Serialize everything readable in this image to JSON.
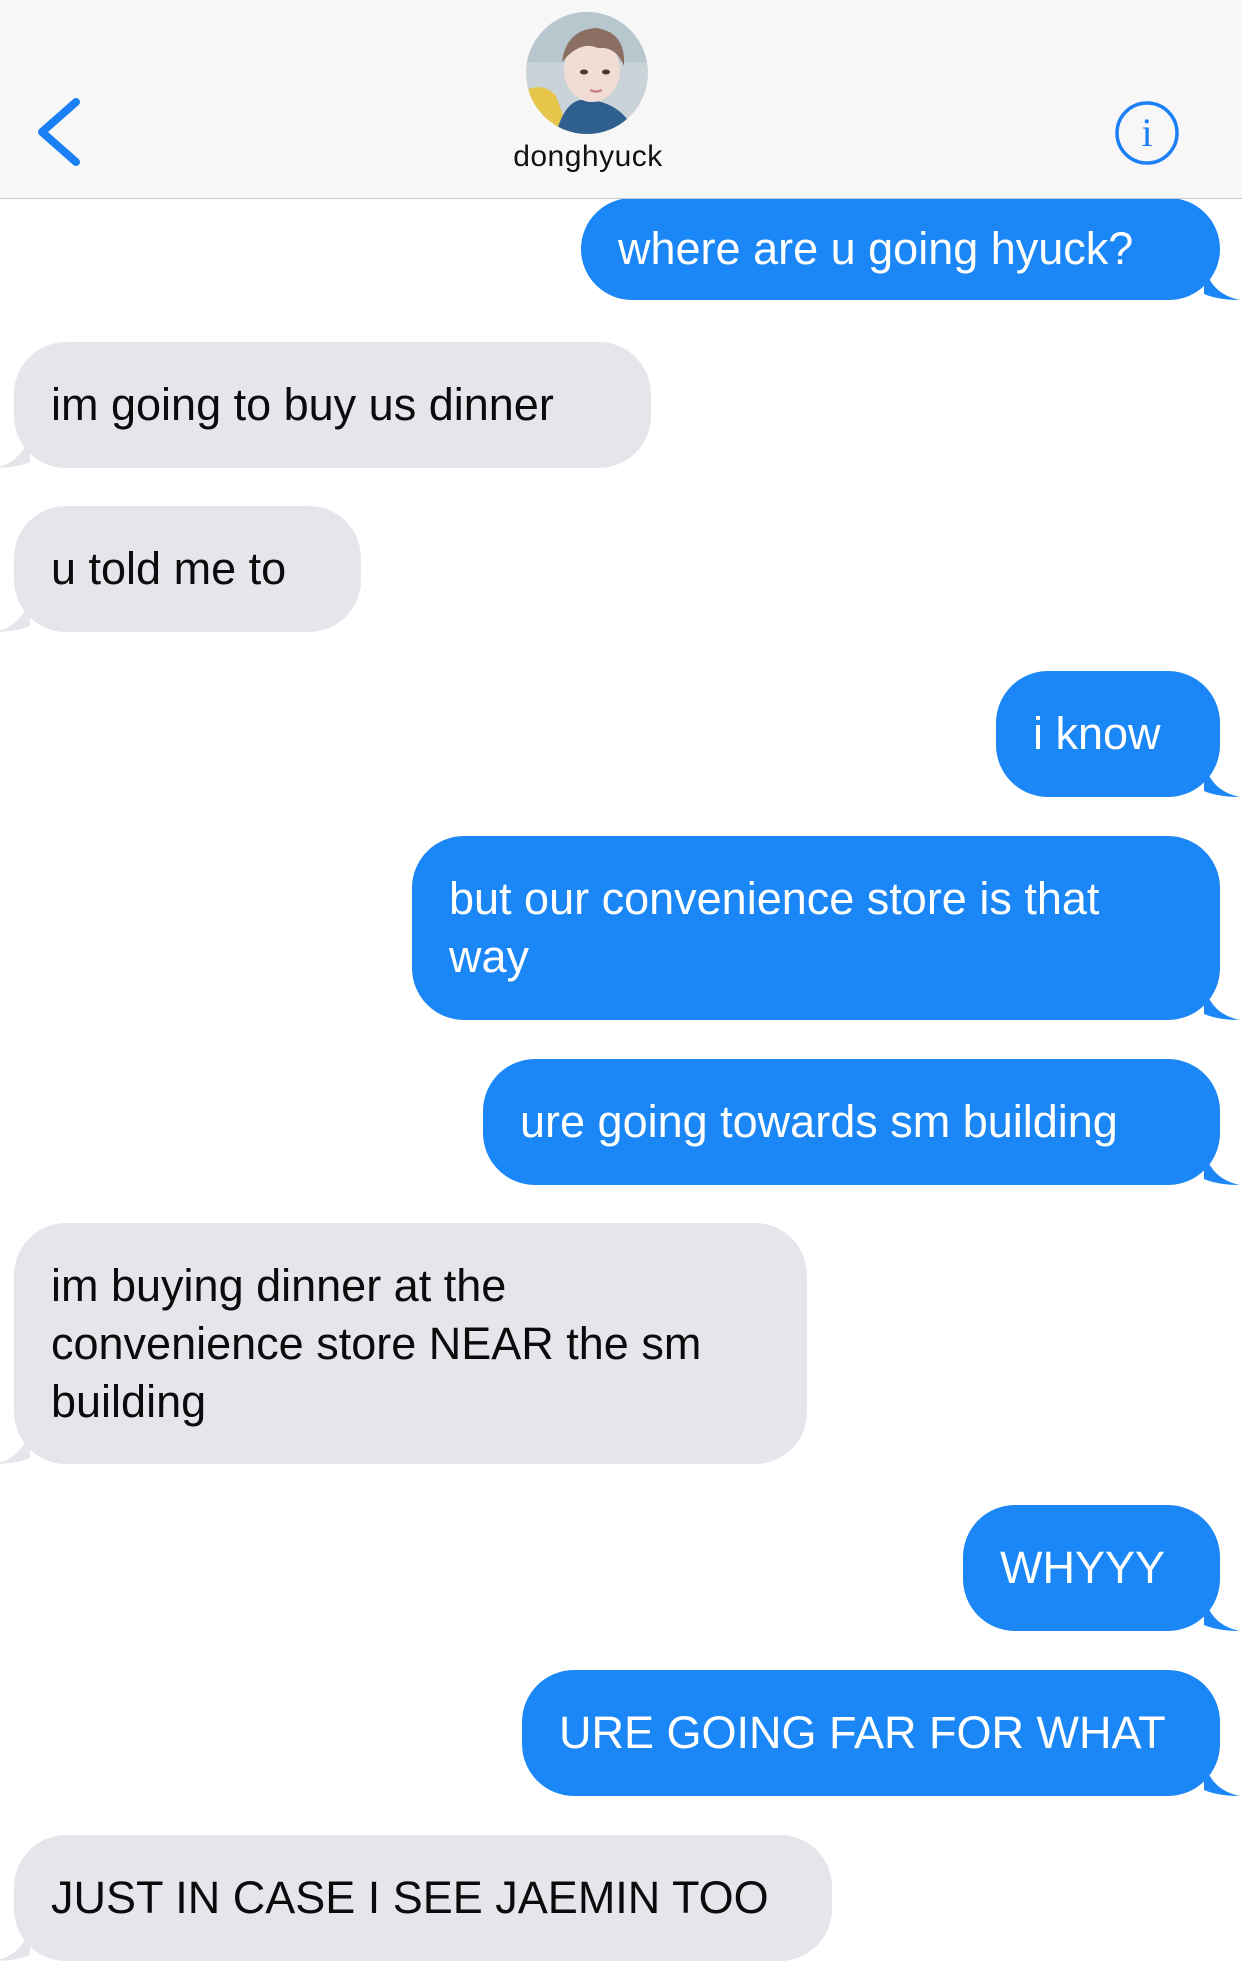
{
  "header": {
    "contact_name": "donghyuck",
    "back_icon": "chevron-left-icon",
    "info_icon": "info-icon",
    "accent": "#1b7ff5"
  },
  "colors": {
    "sent_bubble": "#1b87f6",
    "received_bubble": "#e6e5eb"
  },
  "messages": [
    {
      "direction": "sent",
      "text": "where are u going hyuck?"
    },
    {
      "direction": "received",
      "text": "im going to buy us dinner"
    },
    {
      "direction": "received",
      "text": "u told me to"
    },
    {
      "direction": "sent",
      "text": "i know"
    },
    {
      "direction": "sent",
      "text": "but our convenience store is that\nway"
    },
    {
      "direction": "sent",
      "text": "ure going towards sm building"
    },
    {
      "direction": "received",
      "text": "im buying dinner at the\nconvenience store NEAR the sm\nbuilding"
    },
    {
      "direction": "sent",
      "text": "WHYYY"
    },
    {
      "direction": "sent",
      "text": "URE GOING FAR FOR WHAT"
    },
    {
      "direction": "received",
      "text": "JUST IN CASE I SEE JAEMIN TOO"
    }
  ]
}
